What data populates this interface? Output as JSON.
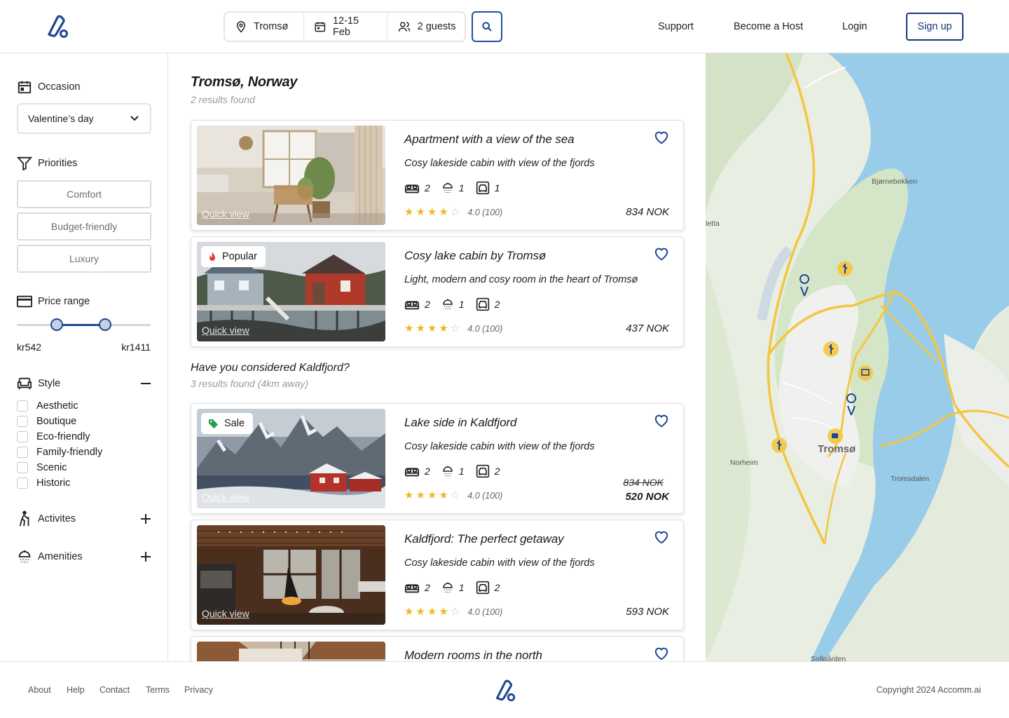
{
  "header": {
    "search": {
      "location": "Tromsø",
      "dates": "12-15 Feb",
      "guests": "2 guests"
    },
    "nav": [
      "Support",
      "Become a Host",
      "Login"
    ],
    "signup": "Sign up"
  },
  "filters": {
    "occasion": {
      "label": "Occasion",
      "value": "Valentine’s day"
    },
    "priorities": {
      "label": "Priorities",
      "options": [
        "Comfort",
        "Budget-friendly",
        "Luxury"
      ]
    },
    "price": {
      "label": "Price range",
      "min": "kr542",
      "max": "kr1411",
      "range_fraction": [
        0.3,
        0.66
      ]
    },
    "style": {
      "label": "Style",
      "options": [
        "Aesthetic",
        "Boutique",
        "Eco-friendly",
        "Family-friendly",
        "Scenic",
        "Historic"
      ]
    },
    "activities": "Activites",
    "amenities": "Amenities"
  },
  "results": {
    "location": "Tromsø, Norway",
    "count": "2 results found",
    "quick_view": "Quick view",
    "listings": [
      {
        "title": "Apartment with a view of the sea",
        "desc": "Cosy lakeside cabin with view of the fjords",
        "beds": "2",
        "showers": "1",
        "cars": "1",
        "rating": "4.0 (100)",
        "stars": 4,
        "price": "834 NOK"
      },
      {
        "title": "Cosy lake cabin by Tromsø",
        "desc": "Light, modern and cosy room in the heart of Tromsø",
        "beds": "2",
        "showers": "1",
        "cars": "2",
        "rating": "4.0 (100)",
        "stars": 4,
        "price": "437 NOK",
        "badge": "Popular"
      }
    ],
    "alt_title": "Have you considered Kaldfjord?",
    "alt_count": "3 results found (4km away)",
    "alt_listings": [
      {
        "title": "Lake side in Kaldfjord",
        "desc": "Cosy lakeside cabin with view of the fjords",
        "beds": "2",
        "showers": "1",
        "cars": "2",
        "rating": "4.0 (100)",
        "stars": 4,
        "old_price": "834 NOK",
        "price": "520 NOK",
        "badge": "Sale"
      },
      {
        "title": "Kaldfjord: The perfect getaway",
        "desc": "Cosy lakeside cabin with view of the fjords",
        "beds": "2",
        "showers": "1",
        "cars": "2",
        "rating": "4.0 (100)",
        "stars": 4,
        "price": "593 NOK"
      },
      {
        "title": "Modern rooms in the north"
      }
    ]
  },
  "map": {
    "labels": [
      "Bjørnebekken",
      "letta",
      "Tromsø",
      "Norheim",
      "Tromsdalen",
      "Sollgården"
    ]
  },
  "footer": {
    "links": [
      "About",
      "Help",
      "Contact",
      "Terms",
      "Privacy"
    ],
    "copyright": "Copyright 2024 Accomm.ai"
  },
  "colors": {
    "brand": "#1d4796",
    "star": "#f5b521",
    "water": "#9dd1ec",
    "land": "#e6efe0"
  }
}
